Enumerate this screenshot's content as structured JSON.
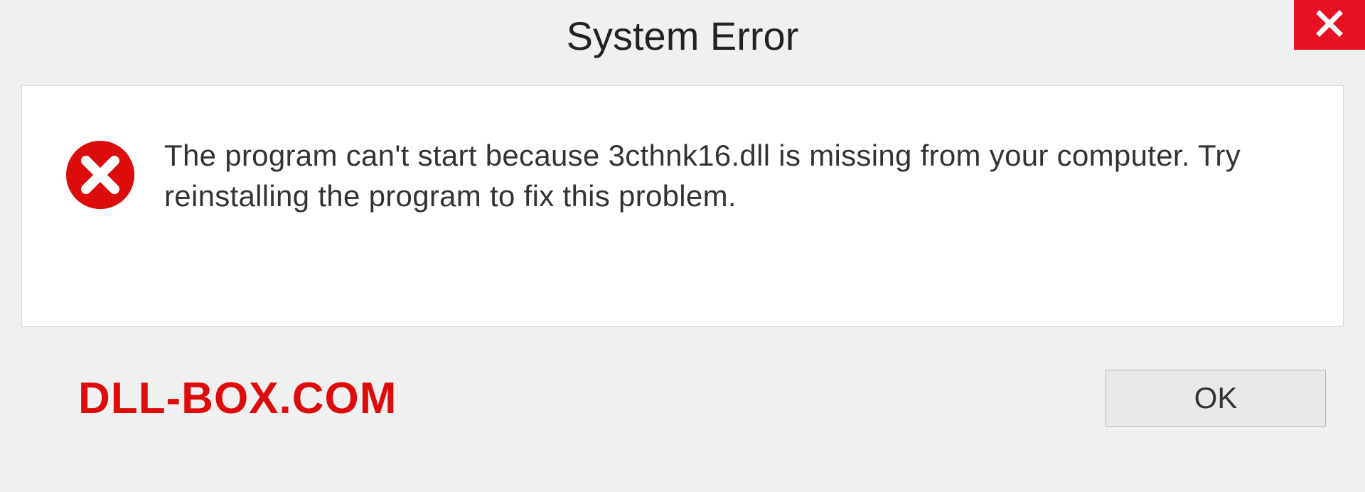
{
  "dialog": {
    "title": "System Error",
    "message": "The program can't start because 3cthnk16.dll is missing from your computer. Try reinstalling the program to fix this problem.",
    "ok_label": "OK"
  },
  "watermark": "DLL-BOX.COM",
  "colors": {
    "close_bg": "#e81123",
    "error_icon": "#dc0c0c",
    "watermark": "#dc0c0c"
  }
}
